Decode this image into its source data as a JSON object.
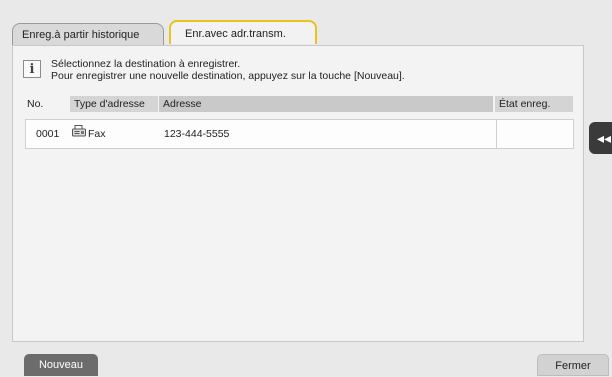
{
  "tabs": [
    {
      "label": "Enreg.à partir historique",
      "active": false
    },
    {
      "label": "Enr.avec adr.transm.",
      "active": true
    }
  ],
  "info": {
    "icon": "info-icon",
    "line1": "Sélectionnez la destination à enregistrer.",
    "line2": "Pour enregistrer une nouvelle destination, appuyez sur la touche [Nouveau]."
  },
  "table": {
    "headers": {
      "no": "No.",
      "type": "Type d'adresse",
      "address": "Adresse",
      "state": "État enreg."
    },
    "rows": [
      {
        "no": "0001",
        "type": "Fax",
        "type_icon": "fax-icon",
        "address": "123-444-5555",
        "state": ""
      }
    ]
  },
  "side_handle": {
    "label": "◂◂"
  },
  "buttons": {
    "new_label": "Nouveau",
    "close_label": "Fermer"
  },
  "colors": {
    "active_tab_border": "#e8c41f",
    "new_button": "#6c6c6c"
  }
}
